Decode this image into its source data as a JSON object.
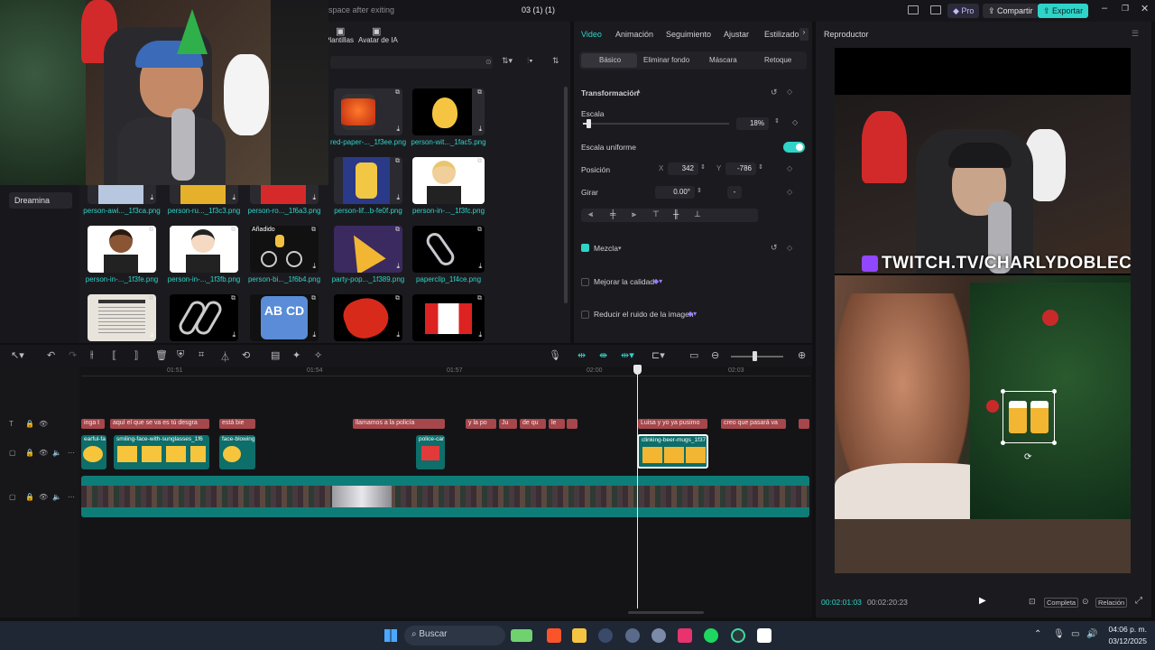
{
  "titlebar": {
    "left_text": "space after exiting",
    "project_title": "03 (1) (1)",
    "pro_label": "Pro",
    "share_label": "Compartir",
    "export_label": "Exportar"
  },
  "leftnav": {
    "item": "Dreamina"
  },
  "mediapanel": {
    "tabs": [
      "Plantillas",
      "Avatar de IA"
    ],
    "added_badge": "Añadido",
    "items_row0": [
      {
        "label": "red-paper-..._1f3ee.png",
        "icon": "red-lantern"
      },
      {
        "label": "person-wit..._1fac5.png",
        "icon": "person-crown"
      }
    ],
    "items_row1": [
      {
        "label": "person-lif...b-fe0f.png",
        "icon": "weightlifter"
      },
      {
        "label": "person-in-..._1f3fc.png",
        "icon": "person-tuxedo"
      }
    ],
    "items_row_partial": [
      {
        "label": "person-awi..._1f3ca.png"
      },
      {
        "label": "person-ru..._1f3c3.png"
      },
      {
        "label": "person-ro..._1f6a3.png"
      }
    ],
    "items_row2": [
      {
        "label": "person-in-..._1f3fe.png"
      },
      {
        "label": "person-in-..._1f3fb.png"
      },
      {
        "label": "person-bi..._1f6b4.png"
      },
      {
        "label": "party-pop..._1f389.png"
      },
      {
        "label": "paperclip_1f4ce.png"
      }
    ],
    "items_row3": [
      {},
      {},
      {
        "text": "AB CD"
      },
      {},
      {}
    ]
  },
  "props": {
    "tabs": [
      "Video",
      "Animación",
      "Seguimiento",
      "Ajustar",
      "Estilizado"
    ],
    "subtabs": [
      "Básico",
      "Eliminar fondo",
      "Máscara",
      "Retoque"
    ],
    "transform": "Transformación",
    "scale_label": "Escala",
    "scale_value": "18%",
    "scale_level": 0.18,
    "uniform_label": "Escala uniforme",
    "uniform_on": true,
    "position_label": "Posición",
    "pos_x_label": "X",
    "pos_x": "342",
    "pos_y_label": "Y",
    "pos_y": "-786",
    "rotate_label": "Girar",
    "rotate_value": "0.00°",
    "rotate_dash": "-",
    "blend_label": "Mezcla",
    "enhance_label": "Mejorar la calidad",
    "denoise_label": "Reducir el ruido de la imagen"
  },
  "player": {
    "title": "Reproductor",
    "overlay_text": "TWITCH.TV/CHARLYDOBLEC",
    "current_time": "00:02:01:03",
    "total_time": "00:02:20:23",
    "full_label": "Completa",
    "ratio_label": "Relación"
  },
  "timeline": {
    "ticks": [
      "01:51",
      "01:54",
      "01:57",
      "02:00",
      "02:03"
    ],
    "captions": [
      {
        "text": "inga t"
      },
      {
        "text": "aquí el que se va es tú desgra"
      },
      {
        "text": "está bie"
      },
      {
        "text": "llamamos a la policía"
      },
      {
        "text": "y la po"
      },
      {
        "text": "Ju"
      },
      {
        "text": "de qu"
      },
      {
        "text": "le"
      },
      {
        "text": "Luisa y yo ya pusimo"
      },
      {
        "text": "creo que pasará va"
      },
      {
        "text": ""
      }
    ],
    "stickers": [
      {
        "name": "earful-fa"
      },
      {
        "name": "smiling-face-with-sunglasses_1f6"
      },
      {
        "name": "face-blowing"
      },
      {
        "name": "police-car"
      },
      {
        "name": "clinking-beer-mugs_1f37"
      }
    ]
  },
  "taskbar": {
    "search_placeholder": "Buscar",
    "time": "04:06 p. m.",
    "date": "03/12/2025"
  },
  "colors": {
    "accent": "#2fd3c8",
    "caption": "#a5474b",
    "sticker": "#0d6e6a"
  }
}
